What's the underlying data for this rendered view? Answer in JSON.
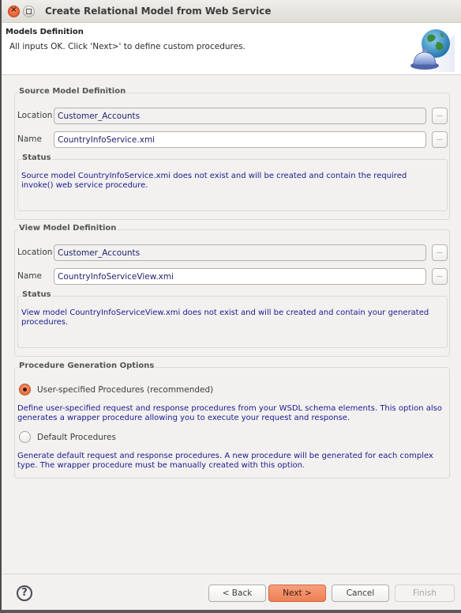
{
  "window": {
    "title": "Create Relational Model from Web Service",
    "close_icon": "close-icon",
    "maximize_icon": "maximize-icon"
  },
  "header": {
    "title": "Models Definition",
    "message": "All inputs OK. Click 'Next>' to define custom procedures.",
    "icon": "globe-service-bell-icon"
  },
  "source": {
    "group_title": "Source Model Definition",
    "location_label": "Location",
    "location_value": "Customer_Accounts",
    "name_label": "Name",
    "name_value": "CountryInfoService.xmi",
    "browse_label": "...",
    "status_title": "Status",
    "status_text": "Source model CountryInfoService.xmi does not exist and will be created and contain the required invoke() web service procedure."
  },
  "view": {
    "group_title": "View Model Definition",
    "location_label": "Location",
    "location_value": "Customer_Accounts",
    "name_label": "Name",
    "name_value": "CountryInfoServiceView.xmi",
    "browse_label": "...",
    "status_title": "Status",
    "status_text": "View model CountryInfoServiceView.xmi does not exist and will be created and contain your generated procedures."
  },
  "options": {
    "group_title": "Procedure Generation Options",
    "items": [
      {
        "label": "User-specified Procedures (recommended)",
        "selected": true,
        "description": "Define user-specified request and response procedures from your WSDL schema elements. This option also generates a wrapper procedure allowing you to execute your request and response."
      },
      {
        "label": "Default Procedures",
        "selected": false,
        "description": "Generate default request and response procedures. A new procedure will be generated for each complex type. The wrapper procedure must be manually created with this option."
      }
    ]
  },
  "footer": {
    "help_icon": "help-icon",
    "help_glyph": "?",
    "back_label": "< Back",
    "next_label": "Next >",
    "cancel_label": "Cancel",
    "finish_label": "Finish"
  },
  "colors": {
    "accent": "#ee7f54",
    "status_text": "#1a1a8c"
  }
}
